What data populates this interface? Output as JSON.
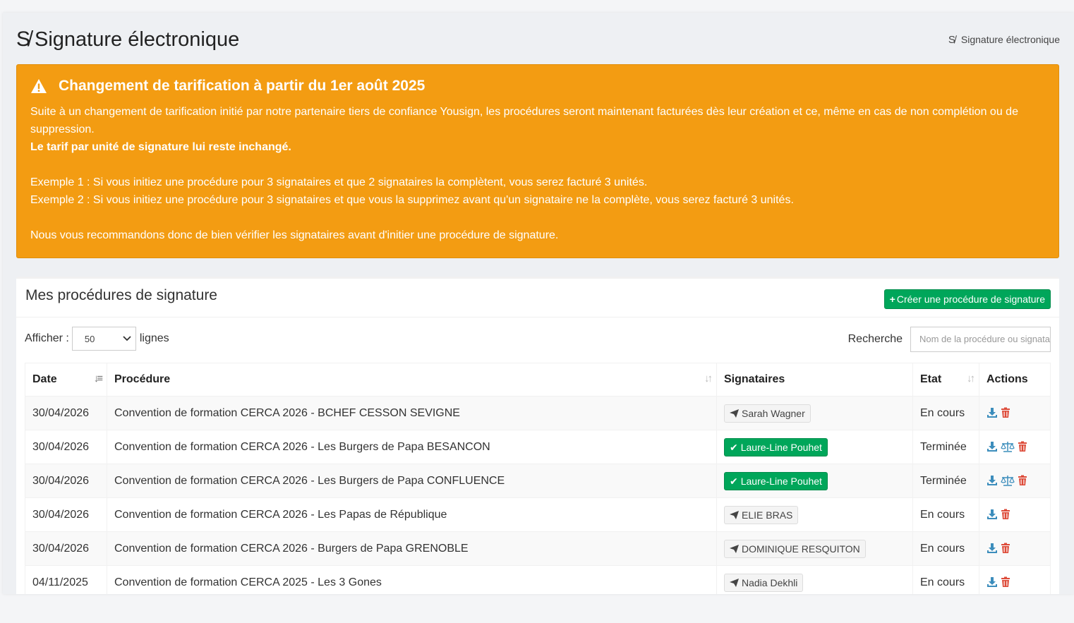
{
  "header": {
    "title": "Signature électronique",
    "breadcrumb": "Signature électronique"
  },
  "alert": {
    "title": "Changement de tarification à partir du 1er août 2025",
    "paragraph1": "Suite à un changement de tarification initié par notre partenaire tiers de confiance Yousign, les procédures seront maintenant facturées dès leur création et ce, même en cas de non complétion ou de suppression.",
    "bold_line": "Le tarif par unité de signature lui reste inchangé.",
    "example1": "Exemple 1 : Si vous initiez une procédure pour 3 signataires et que 2 signataires la complètent, vous serez facturé 3 unités.",
    "example2": "Exemple 2 : Si vous initiez une procédure pour 3 signataires et que vous la supprimez avant qu'un signataire ne la complète, vous serez facturé 3 unités.",
    "recommendation": "Nous vous recommandons donc de bien vérifier les signataires avant d'initier une procédure de signature.",
    "color": "#f39c12"
  },
  "card": {
    "title": "Mes procédures de signature",
    "create_button": "Créer une procédure de signature",
    "show_label": "Afficher :",
    "show_value": "50",
    "show_suffix": "lignes",
    "search_label": "Recherche",
    "search_placeholder": "Nom de la procédure ou signataire"
  },
  "table": {
    "columns": [
      "Date",
      "Procédure",
      "Signataires",
      "Etat",
      "Actions"
    ],
    "rows": [
      {
        "date": "30/04/2026",
        "procedure": "Convention de formation CERCA 2026 - BCHEF CESSON SEVIGNE",
        "signer": "Sarah Wagner",
        "signer_status": "pending",
        "state": "En cours"
      },
      {
        "date": "30/04/2026",
        "procedure": "Convention de formation CERCA 2026 - Les Burgers de Papa BESANCON",
        "signer": "Laure-Line Pouhet",
        "signer_status": "done",
        "state": "Terminée"
      },
      {
        "date": "30/04/2026",
        "procedure": "Convention de formation CERCA 2026 - Les Burgers de Papa CONFLUENCE",
        "signer": "Laure-Line Pouhet",
        "signer_status": "done",
        "state": "Terminée"
      },
      {
        "date": "30/04/2026",
        "procedure": "Convention de formation CERCA 2026 - Les Papas de République",
        "signer": "ELIE BRAS",
        "signer_status": "pending",
        "state": "En cours"
      },
      {
        "date": "30/04/2026",
        "procedure": "Convention de formation CERCA 2026 - Burgers de Papa GRENOBLE",
        "signer": "DOMINIQUE RESQUITON",
        "signer_status": "pending",
        "state": "En cours"
      },
      {
        "date": "04/11/2025",
        "procedure": "Convention de formation CERCA 2025 - Les 3 Gones",
        "signer": "Nadia Dekhli",
        "signer_status": "pending",
        "state": "En cours"
      }
    ]
  },
  "colors": {
    "success": "#00a65a",
    "download": "#3c8dbc",
    "delete": "#dd4b39"
  }
}
